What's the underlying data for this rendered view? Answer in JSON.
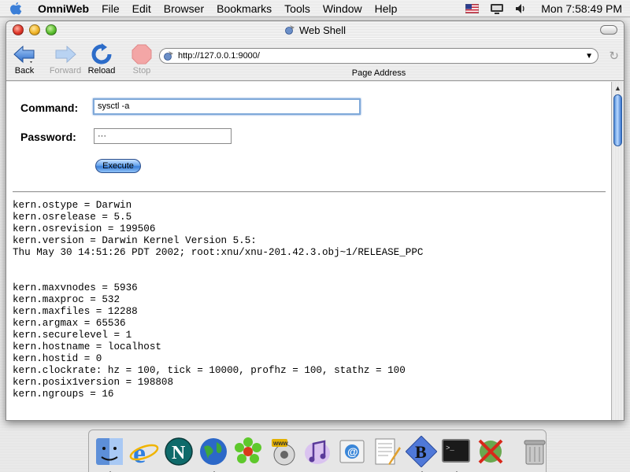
{
  "menubar": {
    "app_name": "OmniWeb",
    "items": [
      "File",
      "Edit",
      "Browser",
      "Bookmarks",
      "Tools",
      "Window",
      "Help"
    ],
    "clock": "Mon 7:58:49 PM"
  },
  "window": {
    "title": "Web Shell"
  },
  "toolbar": {
    "back_label": "Back",
    "forward_label": "Forward",
    "reload_label": "Reload",
    "stop_label": "Stop",
    "address_value": "http://127.0.0.1:9000/",
    "address_caption": "Page Address"
  },
  "form": {
    "command_label": "Command:",
    "command_value": "sysctl -a",
    "password_label": "Password:",
    "password_value": "···",
    "execute_label": "Execute"
  },
  "output": {
    "text": "kern.ostype = Darwin\nkern.osrelease = 5.5\nkern.osrevision = 199506\nkern.version = Darwin Kernel Version 5.5:\nThu May 30 14:51:26 PDT 2002; root:xnu/xnu-201.42.3.obj~1/RELEASE_PPC\n\n\nkern.maxvnodes = 5936\nkern.maxproc = 532\nkern.maxfiles = 12288\nkern.argmax = 65536\nkern.securelevel = 1\nkern.hostname = localhost\nkern.hostid = 0\nkern.clockrate: hz = 100, tick = 10000, profhz = 100, stathz = 100\nkern.posix1version = 198808\nkern.ngroups = 16"
  },
  "dock": {
    "icons": [
      "finder-icon",
      "internet-explorer-icon",
      "netscape-icon",
      "network-globe-icon",
      "icq-icon",
      "www-app-icon",
      "itunes-icon",
      "mail-icon",
      "textedit-icon",
      "bbedit-icon",
      "terminal-icon",
      "classic-disabled-icon",
      "trash-icon"
    ]
  },
  "colors": {
    "accent_blue": "#3b7fd8",
    "stop_red": "#e04a4a"
  }
}
